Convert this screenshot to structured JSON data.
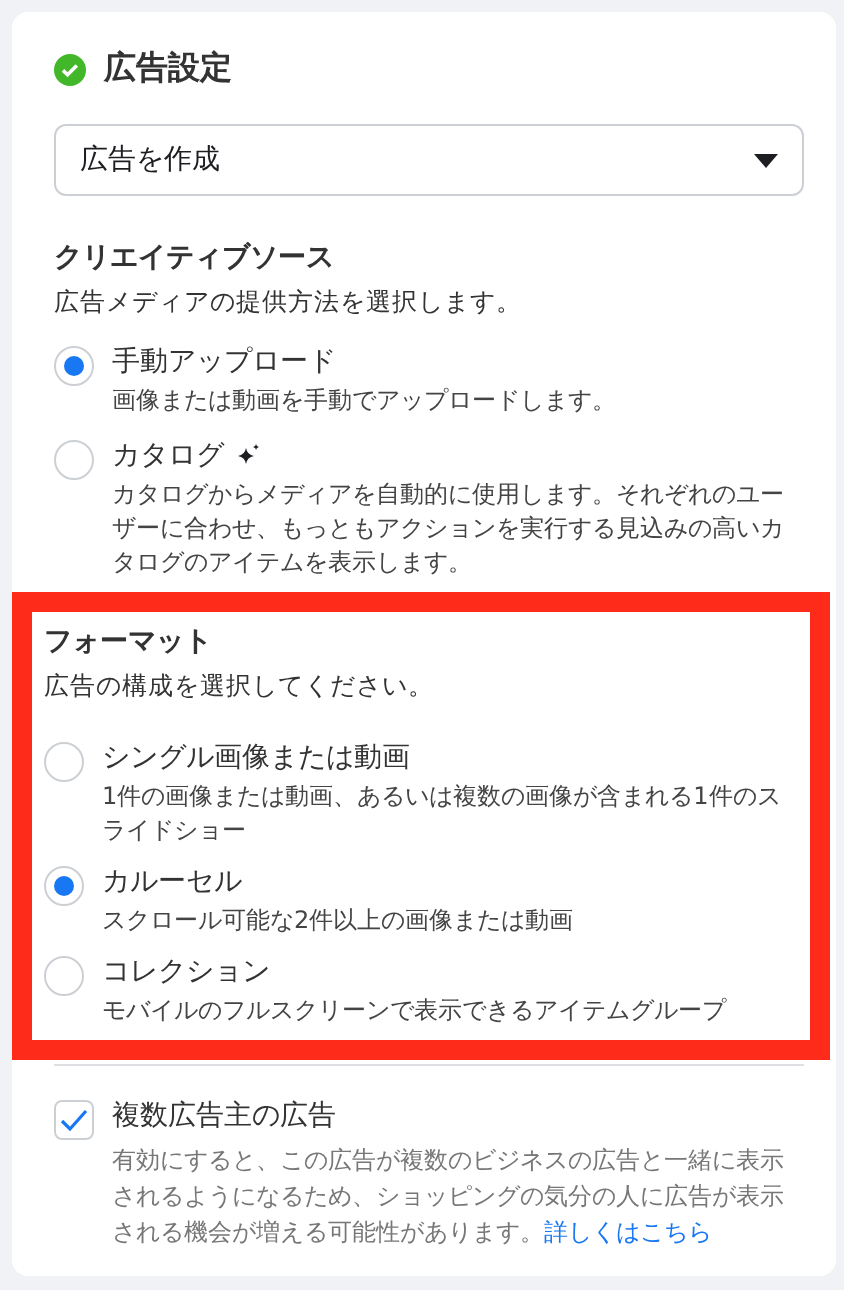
{
  "header": {
    "title": "広告設定",
    "complete": true
  },
  "dropdown": {
    "value": "広告を作成"
  },
  "sections": [
    {
      "title": "クリエイティブソース",
      "subtitle": "広告メディアの提供方法を選択します。",
      "highlighted": false,
      "options": [
        {
          "label": "手動アップロード",
          "description": "画像または動画を手動でアップロードします。",
          "selected": true
        },
        {
          "label": "カタログ",
          "description": "カタログからメディアを自動的に使用します。それぞれのユーザーに合わせ、もっともアクションを実行する見込みの高いカタログのアイテムを表示します。",
          "selected": false,
          "sparkle": true
        }
      ]
    },
    {
      "title": "フォーマット",
      "subtitle": "広告の構成を選択してください。",
      "highlighted": true,
      "options": [
        {
          "label": "シングル画像または動画",
          "description": "1件の画像または動画、あるいは複数の画像が含まれる1件のスライドショー",
          "selected": false
        },
        {
          "label": "カルーセル",
          "description": "スクロール可能な2件以上の画像または動画",
          "selected": true
        },
        {
          "label": "コレクション",
          "description": "モバイルのフルスクリーンで表示できるアイテムグループ",
          "selected": false
        }
      ]
    }
  ],
  "multi_advertiser": {
    "label": "複数広告主の広告",
    "checked": true,
    "description": "有効にすると、この広告が複数のビジネスの広告と一緒に表示されるようになるため、ショッピングの気分の人に広告が表示される機会が増える可能性があります。",
    "link": "詳しくはこちら"
  }
}
